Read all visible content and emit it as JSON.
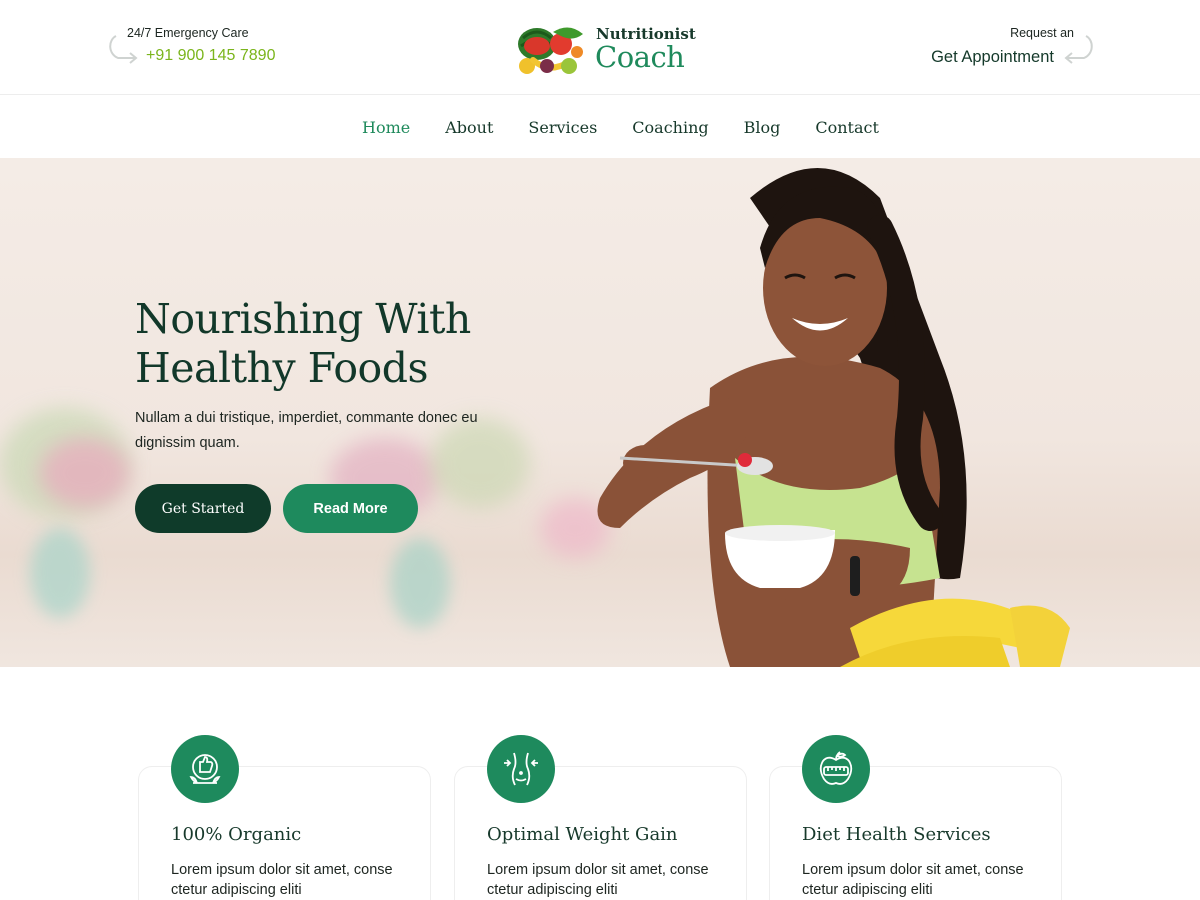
{
  "header": {
    "emergency_label": "24/7 Emergency Care",
    "phone": "+91 900 145 7890",
    "logo_line1": "Nutritionist",
    "logo_line2": "Coach",
    "request_label": "Request an",
    "appointment_label": "Get Appointment"
  },
  "nav": {
    "items": [
      {
        "label": "Home",
        "active": true
      },
      {
        "label": "About"
      },
      {
        "label": "Services"
      },
      {
        "label": "Coaching"
      },
      {
        "label": "Blog"
      },
      {
        "label": "Contact"
      }
    ]
  },
  "hero": {
    "title_line1": "Nourishing With",
    "title_line2": "Healthy Foods",
    "description": "Nullam a dui tristique, imperdiet, commante donec eu dignissim quam.",
    "primary_button": "Get Started",
    "secondary_button": "Read More"
  },
  "services": [
    {
      "title": "100% Organic",
      "text": "Lorem ipsum dolor sit amet, conse ctetur adipiscing eliti",
      "icon": "organic-icon"
    },
    {
      "title": "Optimal Weight Gain",
      "text": "Lorem ipsum dolor sit amet, conse ctetur adipiscing eliti",
      "icon": "body-shape-icon"
    },
    {
      "title": "Diet Health Services",
      "text": "Lorem ipsum dolor sit amet, conse ctetur adipiscing eliti",
      "icon": "apple-measure-icon"
    }
  ],
  "colors": {
    "brand_green": "#1e8a5d",
    "dark_green": "#0f3b2a",
    "accent_lime": "#7bb51c"
  }
}
